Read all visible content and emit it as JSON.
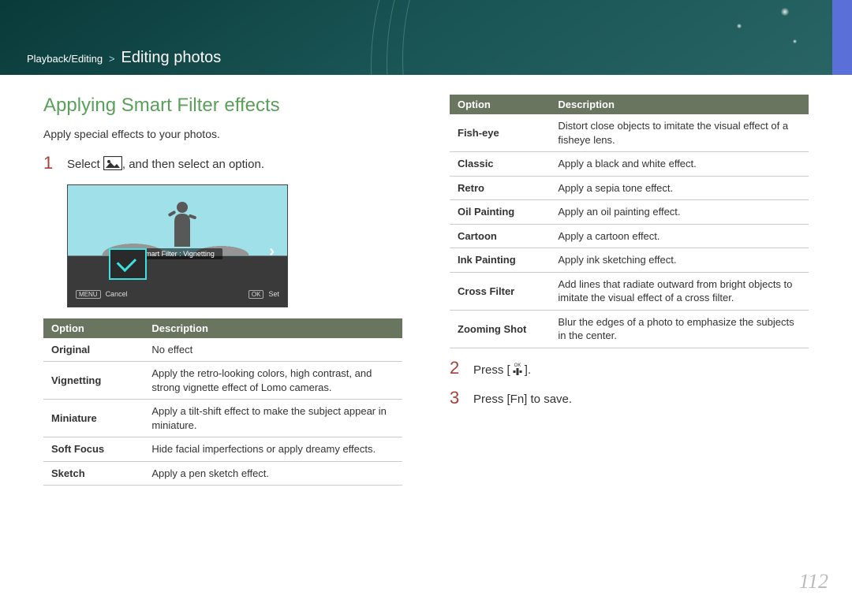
{
  "breadcrumb": {
    "section": "Playback/Editing",
    "separator": ">",
    "page": "Editing photos"
  },
  "section_title": "Applying Smart Filter effects",
  "subtitle": "Apply special effects to your photos.",
  "steps": {
    "s1_num": "1",
    "s1_pre": "Select ",
    "s1_post": ", and then select an option.",
    "s2_num": "2",
    "s2_pre": "Press [",
    "s2_post": "].",
    "s3_num": "3",
    "s3_text": "Press [Fn] to save."
  },
  "screenshot": {
    "label": "Smart Filter : Vignetting",
    "menu_key": "MENU",
    "cancel": "Cancel",
    "ok_key": "OK",
    "set": "Set"
  },
  "table_headers": {
    "option": "Option",
    "description": "Description"
  },
  "options_left": [
    {
      "name": "Original",
      "desc": "No effect"
    },
    {
      "name": "Vignetting",
      "desc": "Apply the retro-looking colors, high contrast, and strong vignette effect of Lomo cameras."
    },
    {
      "name": "Miniature",
      "desc": "Apply a tilt-shift effect to make the subject appear in miniature."
    },
    {
      "name": "Soft Focus",
      "desc": "Hide facial imperfections or apply dreamy effects."
    },
    {
      "name": "Sketch",
      "desc": "Apply a pen sketch effect."
    }
  ],
  "options_right": [
    {
      "name": "Fish-eye",
      "desc": "Distort close objects to imitate the visual effect of a fisheye lens."
    },
    {
      "name": "Classic",
      "desc": "Apply a black and white effect."
    },
    {
      "name": "Retro",
      "desc": "Apply a sepia tone effect."
    },
    {
      "name": "Oil Painting",
      "desc": "Apply an oil painting effect."
    },
    {
      "name": "Cartoon",
      "desc": "Apply a cartoon effect."
    },
    {
      "name": "Ink Painting",
      "desc": "Apply ink sketching effect."
    },
    {
      "name": "Cross Filter",
      "desc": "Add lines that radiate outward from bright objects to imitate the visual effect of a cross filter."
    },
    {
      "name": "Zooming Shot",
      "desc": "Blur the edges of a photo to emphasize the subjects in the center."
    }
  ],
  "page_number": "112"
}
